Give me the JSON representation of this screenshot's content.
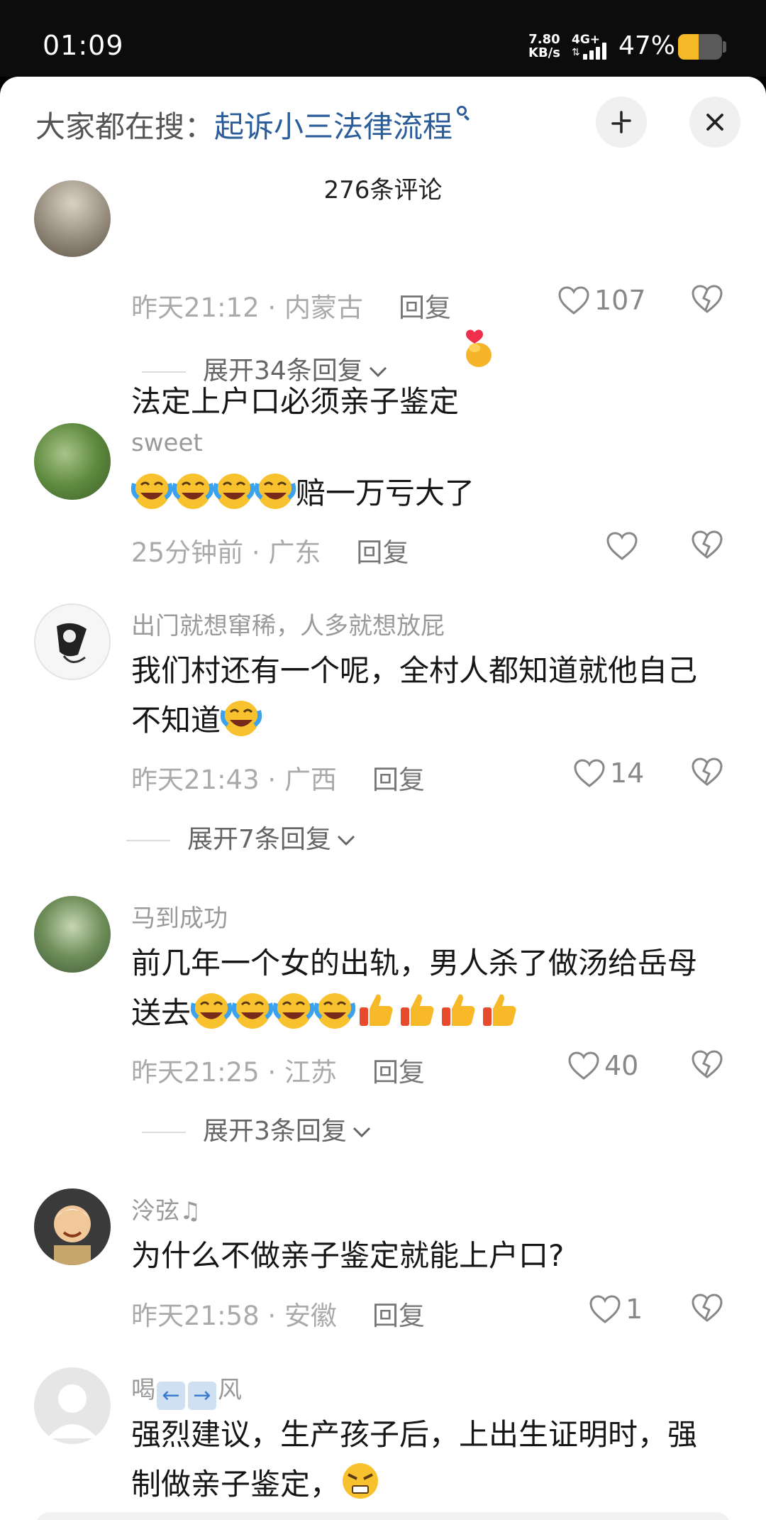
{
  "status_bar": {
    "time": "01:09",
    "net_speed_value": "7.80",
    "net_speed_unit": "KB/s",
    "network": "4G+",
    "battery_percent": "47%",
    "battery_level": 0.47
  },
  "header": {
    "search_prefix": "大家都在搜：",
    "search_query": "起诉小三法律流程",
    "comment_count": "276条评论"
  },
  "comments": [
    {
      "username": "",
      "text": "法定上户口必须亲子鉴定",
      "time": "昨天21:12",
      "location": "内蒙古",
      "reply_label": "回复",
      "likes": "107",
      "expand_label": "展开34条回复"
    },
    {
      "username": "sweet",
      "text_suffix": "赔一万亏大了",
      "time": "25分钟前",
      "location": "广东",
      "reply_label": "回复",
      "likes": ""
    },
    {
      "username": "出门就想窜稀，人多就想放屁",
      "text_line1": "我们村还有一个呢，全村人都知道就他自己",
      "text_line2": "不知道",
      "time": "昨天21:43",
      "location": "广西",
      "reply_label": "回复",
      "likes": "14",
      "expand_label": "展开7条回复"
    },
    {
      "username": "马到成功",
      "text_line1": "前几年一个女的出轨，男人杀了做汤给岳母",
      "text_line2": "送去",
      "time": "昨天21:25",
      "location": "江苏",
      "reply_label": "回复",
      "likes": "40",
      "expand_label": "展开3条回复"
    },
    {
      "username": "泠弦♫",
      "text": "为什么不做亲子鉴定就能上户口?",
      "time": "昨天21:58",
      "location": "安徽",
      "reply_label": "回复",
      "likes": "1"
    },
    {
      "username_part1": "喝",
      "username_part2": "风",
      "text_line1": "强烈建议，生产孩子后，上出生证明时，强",
      "text_line2": "制做亲子鉴定，"
    }
  ],
  "icons": {
    "search": "search-icon",
    "collapse": "collapse-icon",
    "close": "close-icon",
    "like": "heart-outline-icon",
    "dislike": "broken-heart-icon",
    "expand": "chevron-down-icon",
    "emoji_finger_heart": "finger-heart-emoji",
    "emoji_laugh_cry": "laugh-crying-emoji",
    "emoji_thumbs_up": "thumbs-up-emoji",
    "emoji_angry": "angry-emoji",
    "emoji_arrow_left": "left-arrow-emoji",
    "emoji_arrow_right": "right-arrow-emoji"
  },
  "colors": {
    "search_link": "#2b5d9a",
    "text": "#161616",
    "meta": "#aaaaaa",
    "battery": "#f5b928"
  }
}
